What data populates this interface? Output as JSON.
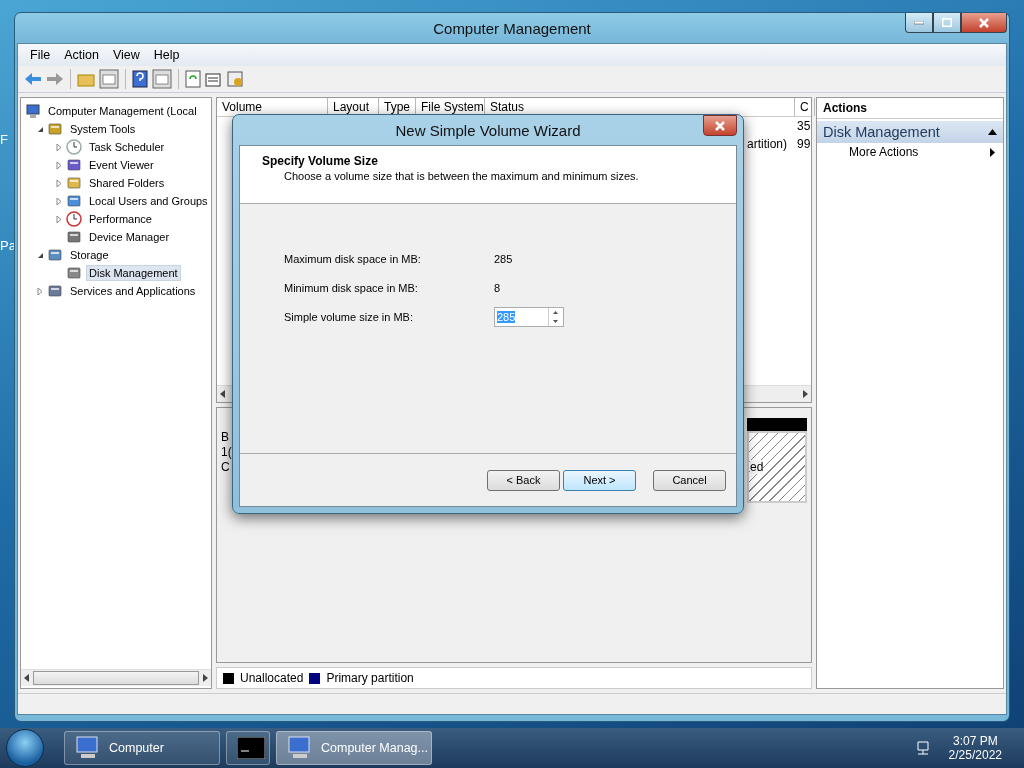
{
  "desktop_fragments": [
    "F",
    "Pa"
  ],
  "window": {
    "title": "Computer Management"
  },
  "menu": [
    "File",
    "Action",
    "View",
    "Help"
  ],
  "tree": [
    {
      "label": "Computer Management (Local",
      "selected": false,
      "children": [
        {
          "label": "System Tools",
          "expanded": true,
          "selected": false,
          "children": [
            {
              "label": "Task Scheduler",
              "expanded": false,
              "selected": false
            },
            {
              "label": "Event Viewer",
              "expanded": false,
              "selected": false
            },
            {
              "label": "Shared Folders",
              "expanded": false,
              "selected": false
            },
            {
              "label": "Local Users and Groups",
              "expanded": false,
              "selected": false
            },
            {
              "label": "Performance",
              "expanded": false,
              "selected": false
            },
            {
              "label": "Device Manager",
              "selected": false
            }
          ]
        },
        {
          "label": "Storage",
          "expanded": true,
          "selected": false,
          "children": [
            {
              "label": "Disk Management",
              "selected": true
            }
          ]
        },
        {
          "label": "Services and Applications",
          "expanded": false,
          "selected": false
        }
      ]
    }
  ],
  "volume_list": {
    "columns": [
      "Volume",
      "Layout",
      "Type",
      "File System",
      "Status",
      "C"
    ],
    "rows": [
      {
        "column_6": "35"
      },
      {
        "status": "artition)",
        "column_6": "99"
      }
    ]
  },
  "disk_view": {
    "fragments": [
      "B",
      "1(",
      "C"
    ],
    "partition_fragment": "ed"
  },
  "legend": [
    {
      "label": "Unallocated",
      "color": "#000000"
    },
    {
      "label": "Primary partition",
      "color": "#000080"
    }
  ],
  "actions": {
    "title": "Actions",
    "section": {
      "label": "Disk Management",
      "expanded": true
    },
    "items": [
      {
        "label": "More Actions"
      }
    ]
  },
  "dialog": {
    "title": "New Simple Volume Wizard",
    "heading": "Specify Volume Size",
    "subheading": "Choose a volume size that is between the maximum and minimum sizes.",
    "fields": [
      {
        "kind": "text",
        "label": "Maximum disk space in MB:",
        "value": "285"
      },
      {
        "kind": "text",
        "label": "Minimum disk space in MB:",
        "value": "8"
      },
      {
        "kind": "spinner",
        "label": "Simple volume size in MB:",
        "value": "285",
        "selected": true
      }
    ],
    "buttons": [
      {
        "label": "< Back",
        "default": false
      },
      {
        "label": "Next >",
        "default": true
      },
      {
        "label": "Cancel",
        "default": false
      }
    ]
  },
  "taskbar": {
    "items": [
      {
        "kind": "app",
        "label": "Computer",
        "selected": false
      },
      {
        "kind": "console",
        "selected": false
      },
      {
        "kind": "app",
        "label": "Computer Manag...",
        "selected": true
      }
    ],
    "time": "3:07 PM",
    "date": "2/25/2022"
  }
}
